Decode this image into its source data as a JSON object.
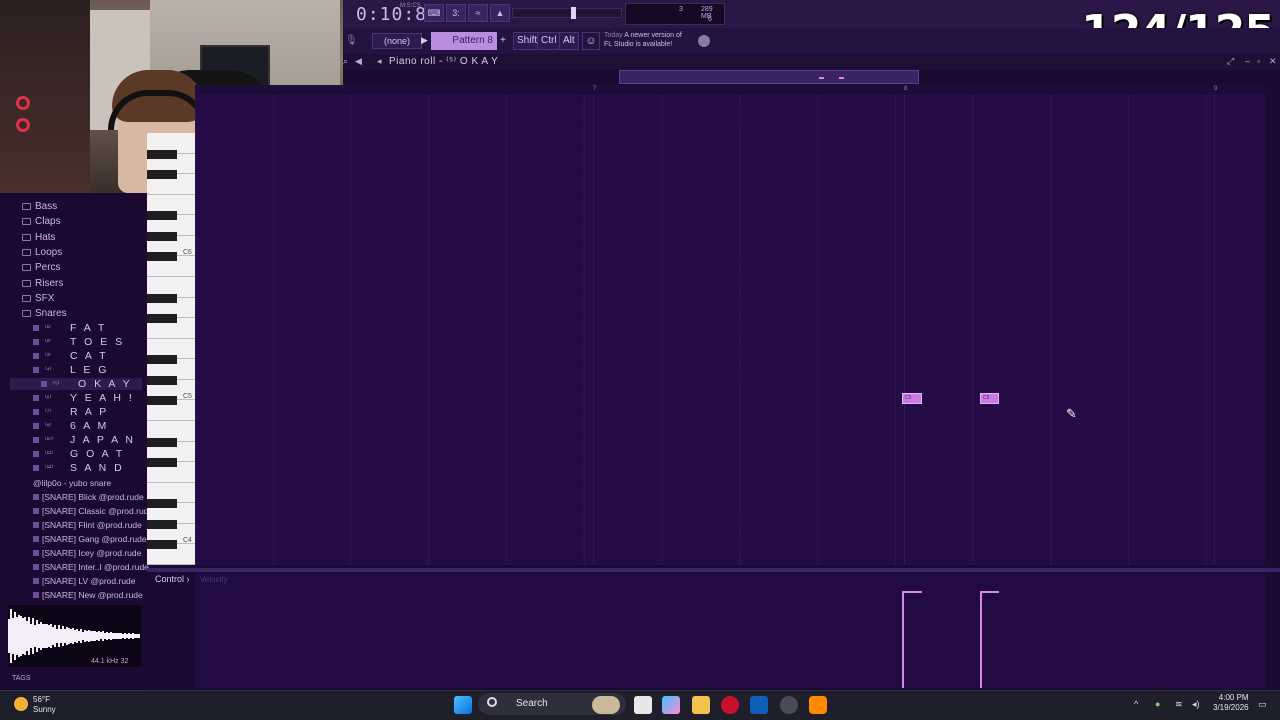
{
  "transport": {
    "time": "0:10:89",
    "time_unit": "M:S:CS",
    "cpu_values": [
      "3",
      "6"
    ],
    "memory": "289 MB"
  },
  "overlay_counter": "124/125",
  "toolbar": {
    "pattern_selector": "(none)",
    "pattern_name": "Pattern 8",
    "mod_keys": [
      "Shift",
      "Ctrl",
      "Alt"
    ],
    "news_day": "Today",
    "news_text_line1": "A newer version of",
    "news_text_line2": "FL Studio is available!"
  },
  "piano_roll": {
    "title": "Piano roll - ⁽⁵⁾ O K A Y",
    "bar_numbers": [
      "7",
      "8",
      "9"
    ],
    "key_labels": [
      "C6",
      "C5",
      "C4"
    ],
    "notes": [
      {
        "label": "C5",
        "bar_start": 8.02,
        "length": 0.06
      },
      {
        "label": "C5",
        "bar_start": 8.27,
        "length": 0.06
      }
    ]
  },
  "browser": {
    "folders": [
      "Bass",
      "Claps",
      "Hats",
      "Loops",
      "Percs",
      "Risers",
      "SFX",
      "Snares"
    ],
    "samples": [
      {
        "idx": "⁽¹⁾",
        "name": "F A T"
      },
      {
        "idx": "⁽²⁾",
        "name": "T O E S"
      },
      {
        "idx": "⁽³⁾",
        "name": "C A T"
      },
      {
        "idx": "⁽⁴⁾",
        "name": "L E G"
      },
      {
        "idx": "⁽⁵⁾",
        "name": "O K A Y"
      },
      {
        "idx": "⁽⁶⁾",
        "name": "Y E A H !"
      },
      {
        "idx": "⁽⁷⁾",
        "name": "R A P"
      },
      {
        "idx": "⁽⁸⁾",
        "name": "6 A M"
      },
      {
        "idx": "⁽¹⁰⁾",
        "name": "J A P A N"
      },
      {
        "idx": "⁽¹¹⁾",
        "name": "G O A T"
      },
      {
        "idx": "⁽¹²⁾",
        "name": "S A N D"
      }
    ],
    "files": [
      "@lilp0o - yubo snare",
      "[SNARE] Blick @prod.rude",
      "[SNARE] Classic @prod.rude",
      "[SNARE] Flint @prod.rude",
      "[SNARE] Gang @prod.rude",
      "[SNARE] Icey @prod.rude",
      "[SNARE] Inter..l @prod.rude",
      "[SNARE] LV @prod.rude",
      "[SNARE] New @prod.rude"
    ],
    "sample_info": "44.1 kHz 32",
    "tags_label": "TAGS"
  },
  "event_editor": {
    "control_label": "Control",
    "param_label": "Velocity"
  },
  "taskbar": {
    "temperature": "56°F",
    "weather": "Sunny",
    "search_label": "Search",
    "time": "4:00 PM",
    "date": "3/19/2026"
  },
  "colors": {
    "note": "#c77be3",
    "grid_bg": "#250b45",
    "velocity_stem": "#d889ee"
  }
}
